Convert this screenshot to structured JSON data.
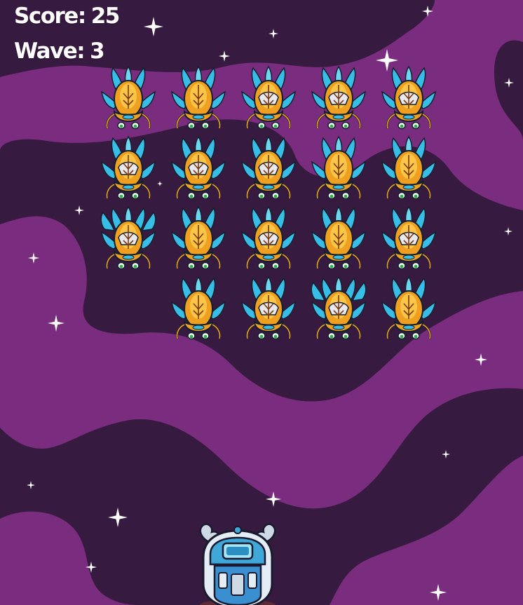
{
  "hud": {
    "score_label": "Score:",
    "score": "25",
    "wave_label": "Wave:",
    "wave": "3"
  },
  "colors": {
    "space_dark": "#371a40",
    "nebula": "#7a2c7f",
    "alien_body": "#f0a020",
    "alien_wing": "#38bde6",
    "hud_text": "#ffffff"
  },
  "icons": {
    "alien": "alien-invader-icon",
    "player": "player-robot-ship-icon",
    "star": "sparkle-star-icon"
  },
  "aliens": {
    "rows": [
      [
        {
          "variant": "a"
        },
        {
          "variant": "a"
        },
        {
          "variant": "b"
        },
        {
          "variant": "b"
        },
        {
          "variant": "b"
        }
      ],
      [
        {
          "variant": "b"
        },
        {
          "variant": "b"
        },
        {
          "variant": "b"
        },
        {
          "variant": "a"
        },
        {
          "variant": "a"
        }
      ],
      [
        {
          "variant": "c"
        },
        {
          "variant": "a"
        },
        {
          "variant": "b"
        },
        {
          "variant": "a"
        },
        {
          "variant": "b"
        }
      ],
      [
        null,
        {
          "variant": "a"
        },
        {
          "variant": "b"
        },
        {
          "variant": "c"
        },
        {
          "variant": "a"
        }
      ]
    ]
  }
}
